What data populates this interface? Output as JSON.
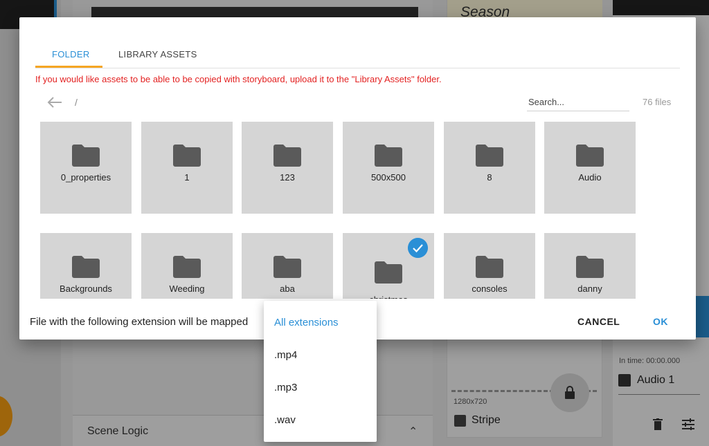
{
  "background": {
    "note_title": "Season",
    "scene_logic_label": "Scene Logic",
    "resolution": "1280x720",
    "layer_name": "Stripe",
    "in_time": "In time: 00:00.000",
    "audio_name": "Audio 1"
  },
  "dialog": {
    "tabs": [
      {
        "label": "FOLDER",
        "active": true
      },
      {
        "label": "LIBRARY ASSETS",
        "active": false
      }
    ],
    "notice": "If you would like assets to be able to be copied with storyboard, upload it to the \"Library Assets\" folder.",
    "path": "/",
    "search_placeholder": "Search...",
    "file_count": "76 files",
    "folders": [
      {
        "name": "0_properties",
        "selected": false
      },
      {
        "name": "1",
        "selected": false
      },
      {
        "name": "123",
        "selected": false
      },
      {
        "name": "500x500",
        "selected": false
      },
      {
        "name": "8",
        "selected": false
      },
      {
        "name": "Audio",
        "selected": false
      },
      {
        "name": "Backgrounds",
        "selected": false
      },
      {
        "name": "Weeding",
        "selected": false
      },
      {
        "name": "aba",
        "selected": false
      },
      {
        "name": "christmas",
        "selected": true
      },
      {
        "name": "consoles",
        "selected": false
      },
      {
        "name": "danny",
        "selected": false
      }
    ],
    "footer_text": "File with the following extension will be mapped",
    "cancel_label": "CANCEL",
    "ok_label": "OK"
  },
  "extension_menu": {
    "options": [
      "All extensions",
      ".mp4",
      ".mp3",
      ".wav"
    ],
    "selected": "All extensions"
  },
  "colors": {
    "accent": "#2a8fd6",
    "tab_indicator": "#f5a623",
    "notice": "#e32222",
    "tile": "#d5d5d5"
  }
}
